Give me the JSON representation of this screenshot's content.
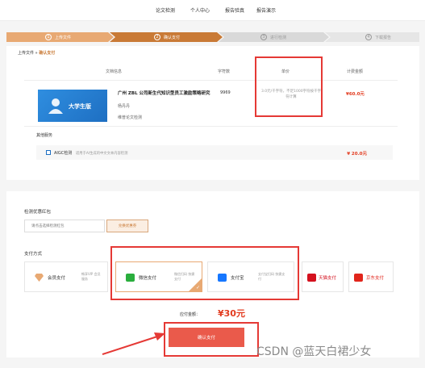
{
  "nav": {
    "items": [
      "论文检测",
      "个人中心",
      "报告验真",
      "报告演示"
    ]
  },
  "steps": [
    {
      "num": "1",
      "label": "上传文件"
    },
    {
      "num": "2",
      "label": "确认支付"
    },
    {
      "num": "3",
      "label": "进行检测"
    },
    {
      "num": "4",
      "label": "下载报告"
    }
  ],
  "breadcrumb": {
    "parent": "上传文件",
    "sep": "»",
    "current": "确认支付"
  },
  "order": {
    "columns": [
      "文档信息",
      "字符数",
      "单价",
      "计费金额"
    ],
    "product_badge": "大学生版",
    "title": "广州 ZBL 公司新生代知识型员工激励策略研究",
    "author": "杨丹丹",
    "service": "维普论文检测",
    "words": "9969",
    "unit_price": "3.0元/千字符，不足1000字符按千字符计算",
    "amount": "¥60.0元"
  },
  "other_services": {
    "title": "其他服务",
    "name": "AIGC检测",
    "desc": "适用于AI生成的中文文本内容检测",
    "price": "¥ 20.0元"
  },
  "coupon": {
    "title": "检测优惠红包",
    "placeholder": "请点击选择检测红包",
    "button": "兑换优惠券"
  },
  "payment": {
    "title": "支付方式",
    "methods": [
      {
        "name": "会员支付",
        "sub": "畅享VIP 会员服务"
      },
      {
        "name": "微信支付",
        "sub": "微信扫码 快捷支付"
      },
      {
        "name": "支付宝",
        "sub": "支付宝扫码 快捷支付"
      },
      {
        "name": "天猫支付",
        "sub": ""
      },
      {
        "name": "京东支付",
        "sub": ""
      }
    ],
    "selected": "微信支付"
  },
  "checkout": {
    "due_label": "应付金额：",
    "due_amount": "¥30元",
    "confirm": "确认支付"
  },
  "watermark": "CSDN @蓝天白裙少女",
  "colors": {
    "accent": "#c97a36",
    "price": "#e23a1e",
    "pay_button": "#ea5a4b",
    "highlight": "#e53935"
  }
}
